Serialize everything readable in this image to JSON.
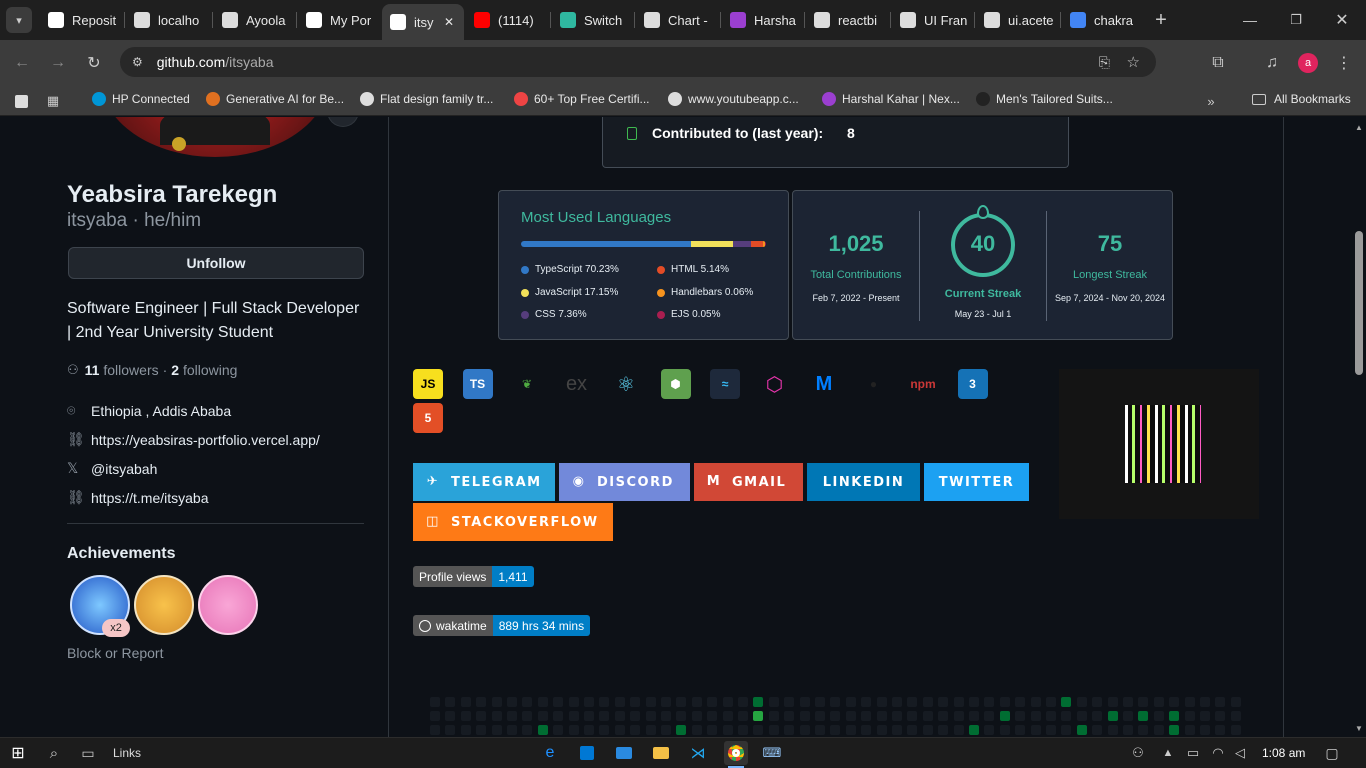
{
  "tabs": [
    {
      "label": "Reposit",
      "fav": "#fff"
    },
    {
      "label": "localho",
      "fav": "#ddd"
    },
    {
      "label": "Ayoola",
      "fav": "#ddd"
    },
    {
      "label": "My Por",
      "fav": "#fff"
    },
    {
      "label": "itsy",
      "fav": "#fff"
    },
    {
      "label": "(1114)",
      "fav": "#ff0000"
    },
    {
      "label": "Switch",
      "fav": "#2fb8a0"
    },
    {
      "label": "Chart -",
      "fav": "#ddd"
    },
    {
      "label": "Harsha",
      "fav": "#9b3fd0"
    },
    {
      "label": "reactbi",
      "fav": "#ddd"
    },
    {
      "label": "UI Fran",
      "fav": "#ddd"
    },
    {
      "label": "ui.acete",
      "fav": "#ddd"
    },
    {
      "label": "chakra",
      "fav": "#4285f4"
    }
  ],
  "address": {
    "domain": "github.com",
    "path": "/itsyaba"
  },
  "bookmarks": [
    {
      "label": "HP Connected",
      "color": "#0096d6"
    },
    {
      "label": "Generative AI for Be...",
      "color": "#e07020"
    },
    {
      "label": "Flat design family tr...",
      "color": "#ddd"
    },
    {
      "label": "60+ Top Free Certifi...",
      "color": "#e44"
    },
    {
      "label": "www.youtubeapp.c...",
      "color": "#ddd"
    },
    {
      "label": "Harshal Kahar | Nex...",
      "color": "#9b3fd0"
    },
    {
      "label": "Men's Tailored Suits...",
      "color": "#222"
    }
  ],
  "all_bookmarks": "All Bookmarks",
  "avatar_letter": "a",
  "profile": {
    "name": "Yeabsira Tarekegn",
    "handle": "itsyaba · he/him",
    "unfollow": "Unfollow",
    "bio": "Software Engineer | Full Stack Developer | 2nd Year University Student",
    "followers_count": "11",
    "followers_label": "followers",
    "dot": "·",
    "following_count": "2",
    "following_label": "following",
    "location": "Ethiopia , Addis Ababa",
    "website": "https://yeabsiras-portfolio.vercel.app/",
    "twitter": "@itsyabah",
    "telegram": "https://t.me/itsyaba",
    "achievements_title": "Achievements",
    "achievement_count": "x2",
    "block": "Block or Report"
  },
  "contrib_top": {
    "label": "Contributed to (last year):",
    "value": "8"
  },
  "languages": {
    "title": "Most Used Languages",
    "items": [
      {
        "name": "TypeScript 70.23%",
        "color": "#3178c6",
        "pct": 70.23
      },
      {
        "name": "JavaScript 17.15%",
        "color": "#f1e05a",
        "pct": 17.15
      },
      {
        "name": "CSS 7.36%",
        "color": "#563d7c",
        "pct": 7.36
      },
      {
        "name": "HTML 5.14%",
        "color": "#e34c26",
        "pct": 5.14
      },
      {
        "name": "Handlebars 0.06%",
        "color": "#f7931e",
        "pct": 0.06
      },
      {
        "name": "EJS 0.05%",
        "color": "#a91e50",
        "pct": 0.05
      }
    ]
  },
  "streak": {
    "total": "1,025",
    "total_label": "Total Contributions",
    "total_range": "Feb 7, 2022 - Present",
    "current": "40",
    "current_label": "Current Streak",
    "current_range": "May 23 - Jul 1",
    "longest": "75",
    "longest_label": "Longest Streak",
    "longest_range": "Sep 7, 2024 - Nov 20, 2024"
  },
  "skills": [
    "JS",
    "TS",
    "mongo",
    "ex",
    "react",
    "node",
    "tailwind",
    "graphql",
    "mui",
    "github",
    "npm",
    "css3",
    "html5"
  ],
  "badges": [
    {
      "label": "TELEGRAM",
      "color": "#2aa3d9"
    },
    {
      "label": "DISCORD",
      "color": "#7289da"
    },
    {
      "label": "GMAIL",
      "color": "#d14836"
    },
    {
      "label": "LINKEDIN",
      "color": "#0077b5"
    },
    {
      "label": "TWITTER",
      "color": "#1ca1f2"
    },
    {
      "label": "STACKOVERFLOW",
      "color": "#fe7a16"
    }
  ],
  "profile_views": {
    "label": "Profile views",
    "value": "1,411"
  },
  "wakatime": {
    "label": "wakatime",
    "value": "889 hrs 34 mins"
  },
  "taskbar": {
    "links": "Links",
    "time": "1:08 am"
  }
}
